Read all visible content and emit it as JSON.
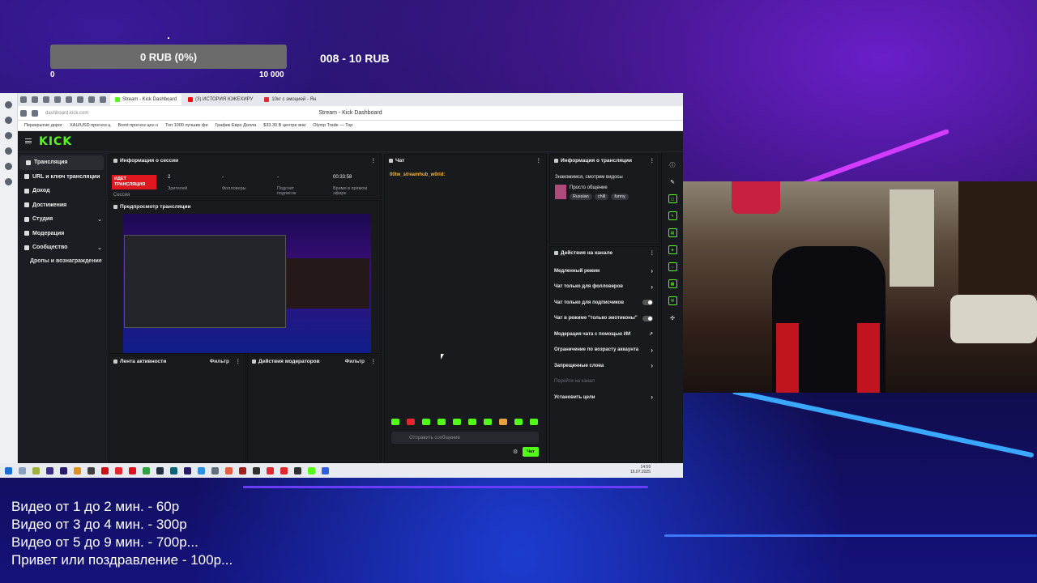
{
  "overlay": {
    "goal_text": "0 RUB (0%)",
    "goal_min": "0",
    "goal_max": "10 000",
    "goal_range": "008 - 10 RUB",
    "goal_progress": 0,
    "price_list": [
      "Видео от 1 до 2 мин. - 60р",
      "Видео от 3 до 4 мин. - 300р",
      "Видео от 5 до 9 мин. - 700р...",
      "Привет или поздравление - 100р..."
    ]
  },
  "browser": {
    "tabs": [
      {
        "label": "Stream - Kick Dashboard",
        "color": "#53fc18",
        "active": true
      },
      {
        "label": "(3) ИСТОРИЯ ЮЖЕХИРУ",
        "color": "#ff0000",
        "active": false
      },
      {
        "label": "10кг с эмоцией - Ян",
        "color": "#e0282e",
        "active": false
      }
    ],
    "url": "dashboard.kick.com",
    "page_title": "Stream - Kick Dashboard",
    "bookmarks": [
      "Перекрытие дорог",
      "XAU/USD прогноз ц",
      "Brent прогноз цен н",
      "Топ 1000 лучших фи",
      "График Евро Долла",
      "$33.30 В центре вни",
      "Olymp Trade — Тор"
    ]
  },
  "kick": {
    "logo": "KICK",
    "nav": [
      {
        "label": "Трансляция",
        "active": true,
        "chevron": false
      },
      {
        "label": "URL и ключ трансляции",
        "active": false,
        "chevron": false
      },
      {
        "label": "Доход",
        "active": false,
        "chevron": false
      },
      {
        "label": "Достижения",
        "active": false,
        "chevron": false
      },
      {
        "label": "Студия",
        "active": false,
        "chevron": true
      },
      {
        "label": "Модерация",
        "active": false,
        "chevron": false
      },
      {
        "label": "Сообщество",
        "active": false,
        "chevron": true
      }
    ],
    "nav_sub": "Дропы и вознаграждение",
    "session": {
      "title": "Информация о сессии",
      "live_badge": "ИДЕТ ТРАНСЛЯЦИЯ",
      "session_label": "Сессия",
      "stats": [
        {
          "value": "2",
          "label": "Зрителей"
        },
        {
          "value": "-",
          "label": "Фолловеры"
        },
        {
          "value": "-",
          "label": "Подсчет подписок"
        },
        {
          "value": "00:33:58",
          "label": "Время в прямом эфире"
        }
      ]
    },
    "preview_title": "Предпросмотр трансляции",
    "activity_title": "Лента активности",
    "mod_actions_title": "Действия модераторов",
    "filter_label": "Фильтр",
    "chat": {
      "title": "Чат",
      "username": "00tw_streamhub_w0rld:",
      "input_placeholder": "Отправить сообщение",
      "send_label": "Чат"
    },
    "stream_info": {
      "title": "Информация о трансляции",
      "stream_title": "Знакомимся, смотрим видосы",
      "category": "Просто общение",
      "tags": [
        "Russian",
        "chill",
        "funny"
      ]
    },
    "channel_actions": {
      "title": "Действия на канале",
      "items": [
        {
          "label": "Медленный режим",
          "control": "chevron"
        },
        {
          "label": "Чат только для фолловеров",
          "control": "chevron"
        },
        {
          "label": "Чат только для подписчиков",
          "control": "toggle"
        },
        {
          "label": "Чат в режиме \"только эмотиконы\"",
          "control": "toggle"
        },
        {
          "label": "Модерация чата с помощью ИИ",
          "control": "external"
        },
        {
          "label": "Ограничение по возрасту аккаунта",
          "control": "chevron"
        },
        {
          "label": "Запрещенные слова",
          "control": "chevron"
        },
        {
          "label": "Перейти на канал",
          "control": "none",
          "dim": true
        },
        {
          "label": "Установить цели",
          "control": "chevron"
        }
      ]
    }
  },
  "taskbar": {
    "time": "14:59",
    "date": "16.07.2025"
  }
}
